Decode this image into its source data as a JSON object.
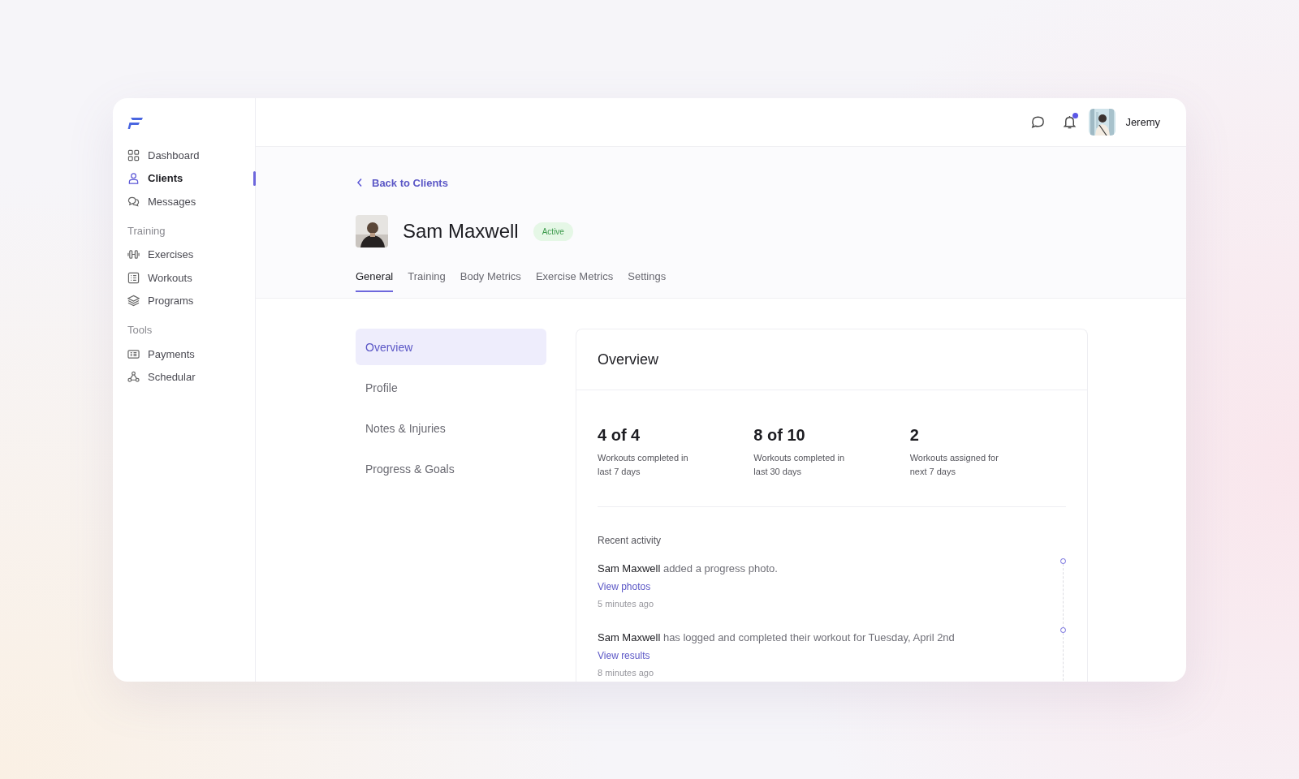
{
  "sidebar": {
    "sections": [
      {
        "items": [
          {
            "label": "Dashboard",
            "kind": "grid",
            "selected": false
          },
          {
            "label": "Clients",
            "kind": "person",
            "selected": true
          },
          {
            "label": "Messages",
            "kind": "chat",
            "selected": false
          }
        ]
      },
      {
        "title": "Training",
        "items": [
          {
            "label": "Exercises",
            "kind": "dumbbell",
            "selected": false
          },
          {
            "label": "Workouts",
            "kind": "list",
            "selected": false
          },
          {
            "label": "Programs",
            "kind": "layers",
            "selected": false
          }
        ]
      },
      {
        "title": "Tools",
        "items": [
          {
            "label": "Payments",
            "kind": "card",
            "selected": false
          },
          {
            "label": "Schedular",
            "kind": "nodes",
            "selected": false
          }
        ]
      }
    ]
  },
  "topbar": {
    "notification_dot": true,
    "user": {
      "name": "Jeremy"
    }
  },
  "back_link": "Back to Clients",
  "client": {
    "name": "Sam Maxwell",
    "status": "Active"
  },
  "tabs": [
    {
      "label": "General",
      "selected": true
    },
    {
      "label": "Training",
      "selected": false
    },
    {
      "label": "Body Metrics",
      "selected": false
    },
    {
      "label": "Exercise Metrics",
      "selected": false
    },
    {
      "label": "Settings",
      "selected": false
    }
  ],
  "side_menu": [
    {
      "label": "Overview",
      "selected": true
    },
    {
      "label": "Profile",
      "selected": false
    },
    {
      "label": "Notes & Injuries",
      "selected": false
    },
    {
      "label": "Progress & Goals",
      "selected": false
    }
  ],
  "overview": {
    "title": "Overview",
    "stats": [
      {
        "value": "4 of 4",
        "label": "Workouts completed in last 7 days"
      },
      {
        "value": "8 of 10",
        "label": "Workouts completed in last 30 days"
      },
      {
        "value": "2",
        "label": "Workouts assigned for next 7 days"
      }
    ],
    "recent_title": "Recent activity",
    "activity": [
      {
        "text": "**Sam Maxwell** added a progress photo.",
        "link": "View photos",
        "time": "5 minutes ago"
      },
      {
        "text": "**Sam Maxwell** has logged and completed their workout for Tuesday, April 2nd",
        "link": "View results",
        "time": "8 minutes ago"
      }
    ]
  }
}
